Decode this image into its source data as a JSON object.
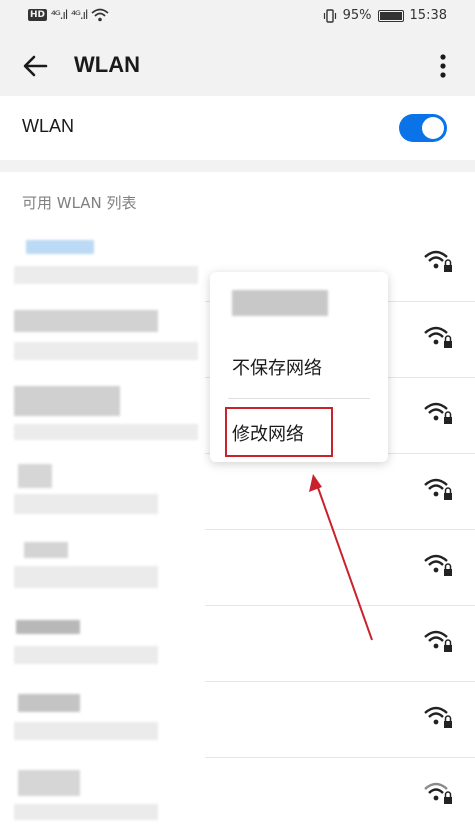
{
  "status_bar": {
    "hd": "HD",
    "signal_1": "⁴ᴳ.ıl",
    "signal_2": "⁴ᴳ.ıl",
    "battery": "95%",
    "time": "15:38"
  },
  "app_bar": {
    "title": "WLAN",
    "back_icon": "arrow-left-icon",
    "more_icon": "more-vertical-icon"
  },
  "wlan_toggle": {
    "label": "WLAN",
    "enabled": true,
    "accent": "#0a73e8"
  },
  "available_list": {
    "header": "可用 WLAN 列表"
  },
  "networks_count_visible": 8,
  "context_menu": {
    "items": [
      {
        "label": "不保存网络"
      },
      {
        "label": "修改网络",
        "highlighted": true
      }
    ]
  },
  "annotation": {
    "color": "#c8232c"
  }
}
